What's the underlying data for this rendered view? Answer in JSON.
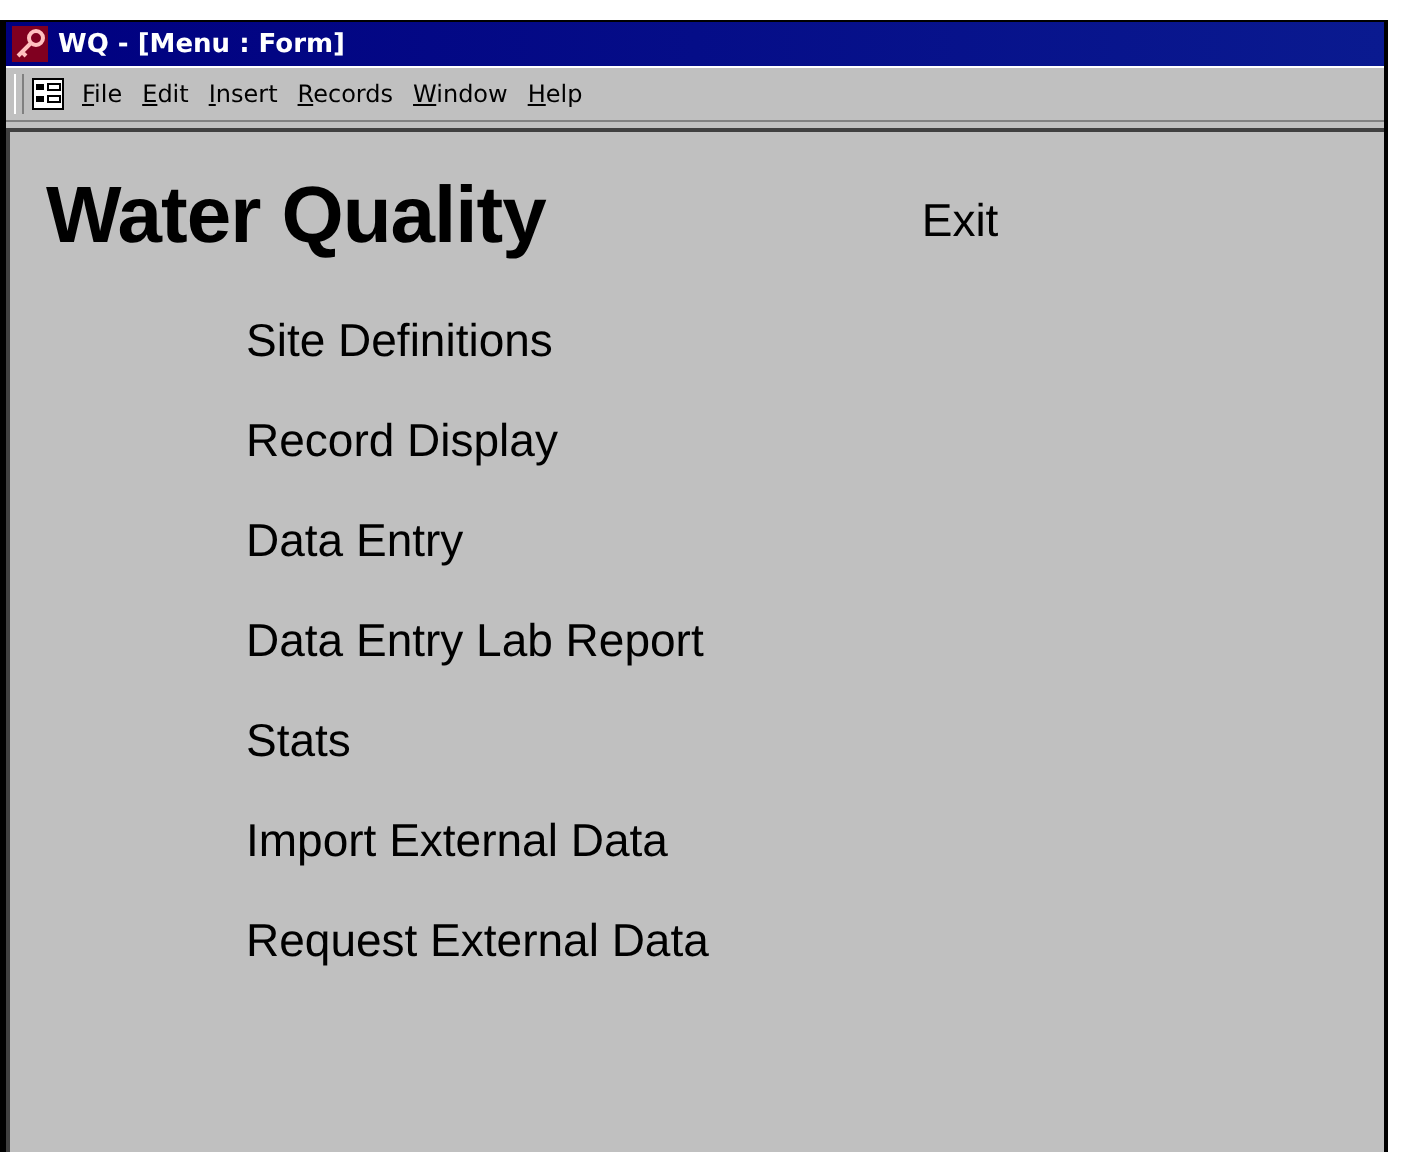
{
  "window": {
    "title": "WQ - [Menu : Form]"
  },
  "menu": [
    "File",
    "Edit",
    "Insert",
    "Records",
    "Window",
    "Help"
  ],
  "form": {
    "title": "Water Quality",
    "exit": "Exit",
    "items": [
      "Site Definitions",
      "Record Display",
      "Data Entry",
      "Data Entry Lab Report",
      "Stats",
      "Import External Data",
      "Request External Data"
    ]
  }
}
